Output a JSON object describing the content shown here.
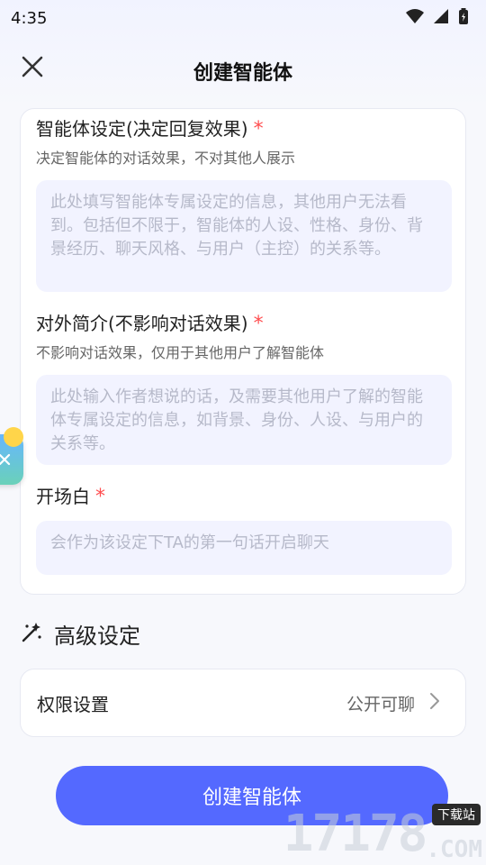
{
  "status_bar": {
    "time": "4:35"
  },
  "header": {
    "title": "创建智能体"
  },
  "form": {
    "setting": {
      "label": "智能体设定(决定回复效果)",
      "required_mark": "*",
      "hint": "决定智能体的对话效果，不对其他人展示",
      "placeholder": "此处填写智能体专属设定的信息，其他用户无法看到。包括但不限于，智能体的人设、性格、身份、背景经历、聊天风格、与用户（主控）的关系等。"
    },
    "intro": {
      "label": "对外简介(不影响对话效果)",
      "required_mark": "*",
      "hint": "不影响对话效果，仅用于其他用户了解智能体",
      "placeholder": "此处输入作者想说的话，及需要其他用户了解的智能体专属设定的信息，如背景、身份、人设、与用户的关系等。"
    },
    "greeting": {
      "label": "开场白",
      "required_mark": "*",
      "placeholder": "会作为该设定下TA的第一句话开启聊天"
    }
  },
  "advanced": {
    "title": "高级设定",
    "permissions": {
      "label": "权限设置",
      "value": "公开可聊"
    }
  },
  "actions": {
    "create_label": "创建智能体"
  },
  "watermark": {
    "digits": "17178",
    "site": "下载站",
    "domain": ".COM"
  },
  "colors": {
    "primary": "#5469ff",
    "required": "#ff4d4f",
    "input_bg": "#f2f3ff"
  }
}
